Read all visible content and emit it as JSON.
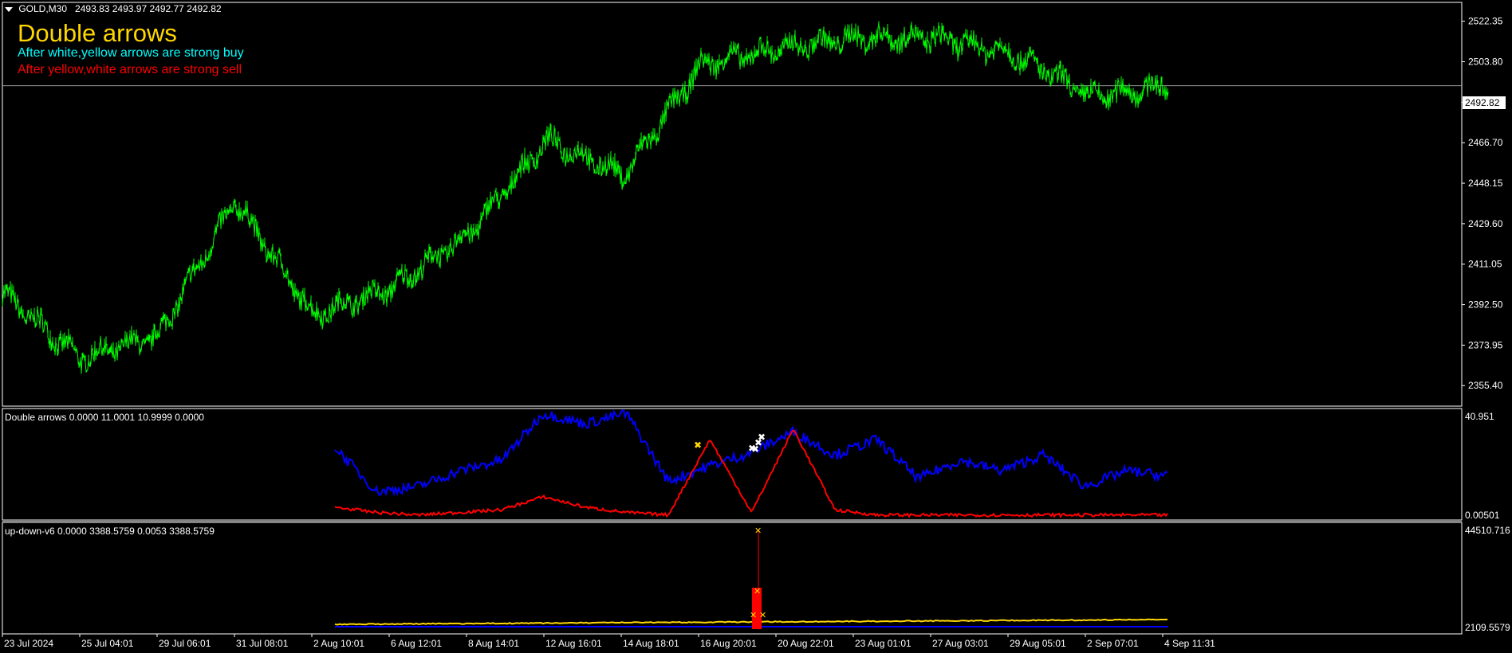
{
  "header": {
    "symbol": "GOLD,M30",
    "ohlc": "2493.83 2493.97 2492.77 2492.82"
  },
  "indicator_info": {
    "title": "Double arrows",
    "buy_text": "After white,yellow arrows are strong buy",
    "sell_text": "After yellow,white arrows are strong sell",
    "title_color": "#ffd700",
    "buy_color": "#00ffff",
    "sell_color": "#ff0000"
  },
  "colors": {
    "background": "#000000",
    "frame": "#ffffff",
    "price_line": "#00ff00",
    "blue_series": "#0000ff",
    "red_series": "#ff0000",
    "yellow_series": "#ffd700",
    "white_arrow": "#ffffff",
    "yellow_arrow": "#ffd700"
  },
  "subwindow1": {
    "label": "Double arrows 0.0000 11.0001 10.9999 0.0000",
    "scale_top": "40.951",
    "scale_bottom": "0.00501"
  },
  "subwindow2": {
    "label": "up-down-v6 0.0000 3388.5759 0.0053 3388.5759",
    "scale_top": "44510.716",
    "scale_bottom": "2109.5579"
  },
  "chart_data": [
    {
      "type": "line",
      "series": [
        {
          "x": [
            "23 Jul 2024",
            "25 Jul 04:01",
            "29 Jul 06:01",
            "31 Jul 08:01",
            "2 Aug 10:01",
            "6 Aug 12:01",
            "8 Aug 14:01",
            "12 Aug 16:01",
            "14 Aug 18:01",
            "16 Aug 20:01",
            "20 Aug 22:01",
            "23 Aug 01:01",
            "27 Aug 03:01",
            "29 Aug 05:01",
            "2 Sep 07:01",
            "4 Sep 11:31"
          ],
          "values": [
            2398,
            2368,
            2378,
            2440,
            2388,
            2400,
            2425,
            2468,
            2452,
            2503,
            2510,
            2515,
            2515,
            2508,
            2488,
            2492.82
          ]
        }
      ],
      "y_ticks": [
        "2522.35",
        "2503.80",
        "2485.25",
        "2466.70",
        "2448.15",
        "2429.60",
        "2411.05",
        "2392.50",
        "2373.95",
        "2355.40"
      ],
      "ylim": [
        2346,
        2531
      ],
      "current_price": "2492.82",
      "x_ticks": [
        "23 Jul 2024",
        "25 Jul 04:01",
        "29 Jul 06:01",
        "31 Jul 08:01",
        "2 Aug 10:01",
        "6 Aug 12:01",
        "8 Aug 14:01",
        "12 Aug 16:01",
        "14 Aug 18:01",
        "16 Aug 20:01",
        "20 Aug 22:01",
        "23 Aug 01:01",
        "27 Aug 03:01",
        "29 Aug 05:01",
        "2 Sep 07:01",
        "4 Sep 11:31"
      ]
    },
    {
      "type": "line",
      "series": [
        {
          "values": [
            27,
            10,
            12,
            18,
            22,
            40,
            36,
            40,
            14,
            20,
            25,
            33,
            24,
            30,
            15,
            22,
            18,
            24,
            12,
            18,
            16
          ]
        },
        {
          "values": [
            4,
            2,
            1,
            2,
            3,
            8,
            4,
            2,
            1,
            30,
            2,
            34,
            3,
            1,
            1,
            1,
            1,
            1,
            1,
            1,
            1
          ]
        }
      ],
      "ylim": [
        0.00501,
        40.951
      ]
    },
    {
      "type": "line",
      "series": [
        {
          "values": [
            2400,
            2200,
            2300,
            2500,
            2800,
            2700,
            2900,
            3300,
            3500,
            4000,
            4600,
            4400,
            4800,
            5200,
            5000
          ]
        },
        {
          "values": [
            2109,
            2109,
            2109,
            2109,
            2109,
            2109,
            2109,
            44510,
            2109,
            2109,
            2109,
            2109,
            2109,
            2109,
            2109
          ]
        }
      ],
      "ylim": [
        2109.5579,
        44510.716
      ]
    }
  ]
}
